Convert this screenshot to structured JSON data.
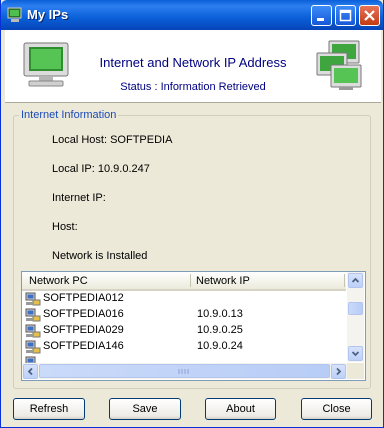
{
  "window": {
    "title": "My IPs"
  },
  "header": {
    "title": "Internet and Network IP Address",
    "status": "Status : Information Retrieved",
    "left_icon": "monitor-icon",
    "right_icon": "network-computers-icon"
  },
  "group": {
    "label": "Internet Information",
    "local_host": "Local Host: SOFTPEDIA",
    "local_ip": "Local IP: 10.9.0.247",
    "internet_ip": "Internet IP:",
    "host": "Host:",
    "network_status": "Network is Installed"
  },
  "list": {
    "columns": [
      "Network PC",
      "Network IP"
    ],
    "rows": [
      {
        "pc": "SOFTPEDIA012",
        "ip": ""
      },
      {
        "pc": "SOFTPEDIA016",
        "ip": "10.9.0.13"
      },
      {
        "pc": "SOFTPEDIA029",
        "ip": "10.9.0.25"
      },
      {
        "pc": "SOFTPEDIA146",
        "ip": "10.9.0.24"
      }
    ]
  },
  "buttons": {
    "refresh": "Refresh",
    "save": "Save",
    "about": "About",
    "close": "Close"
  },
  "colors": {
    "title_bar": "#0a5fd8",
    "header_text": "#000080",
    "group_label": "#1a4ab8"
  }
}
